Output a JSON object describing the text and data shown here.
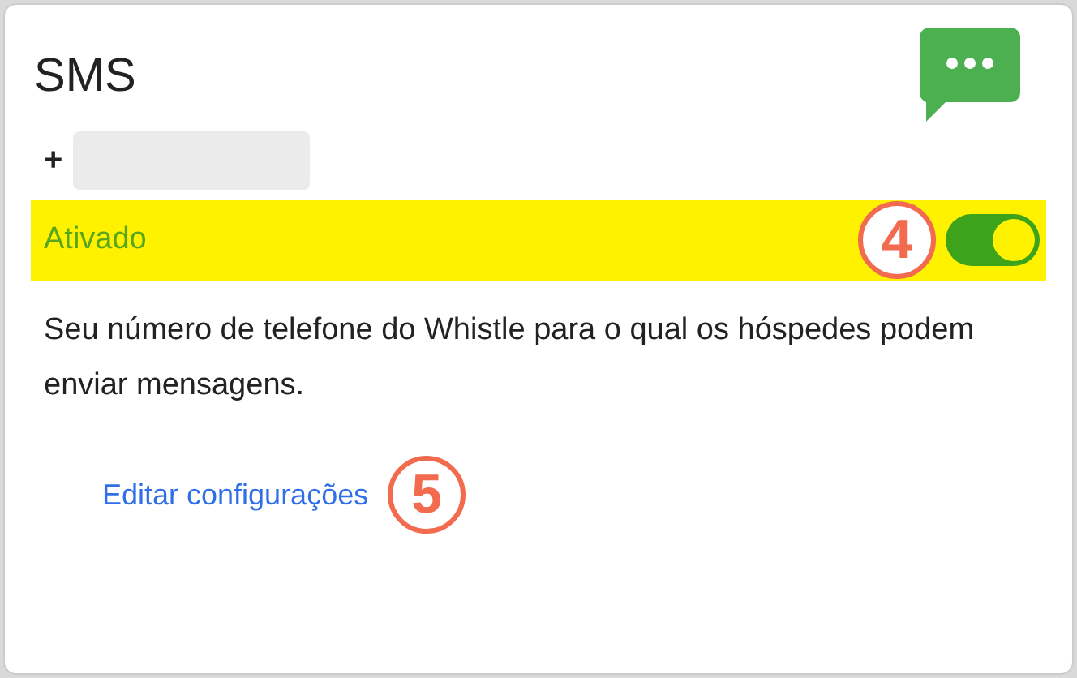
{
  "card": {
    "title": "SMS",
    "phone": {
      "prefix": "+"
    },
    "status": {
      "label": "Ativado",
      "on": true,
      "callout": "4"
    },
    "description": "Seu número de telefone do Whistle para o qual os hóspedes podem enviar mensagens.",
    "link": {
      "label": "Editar configurações",
      "callout": "5"
    }
  }
}
